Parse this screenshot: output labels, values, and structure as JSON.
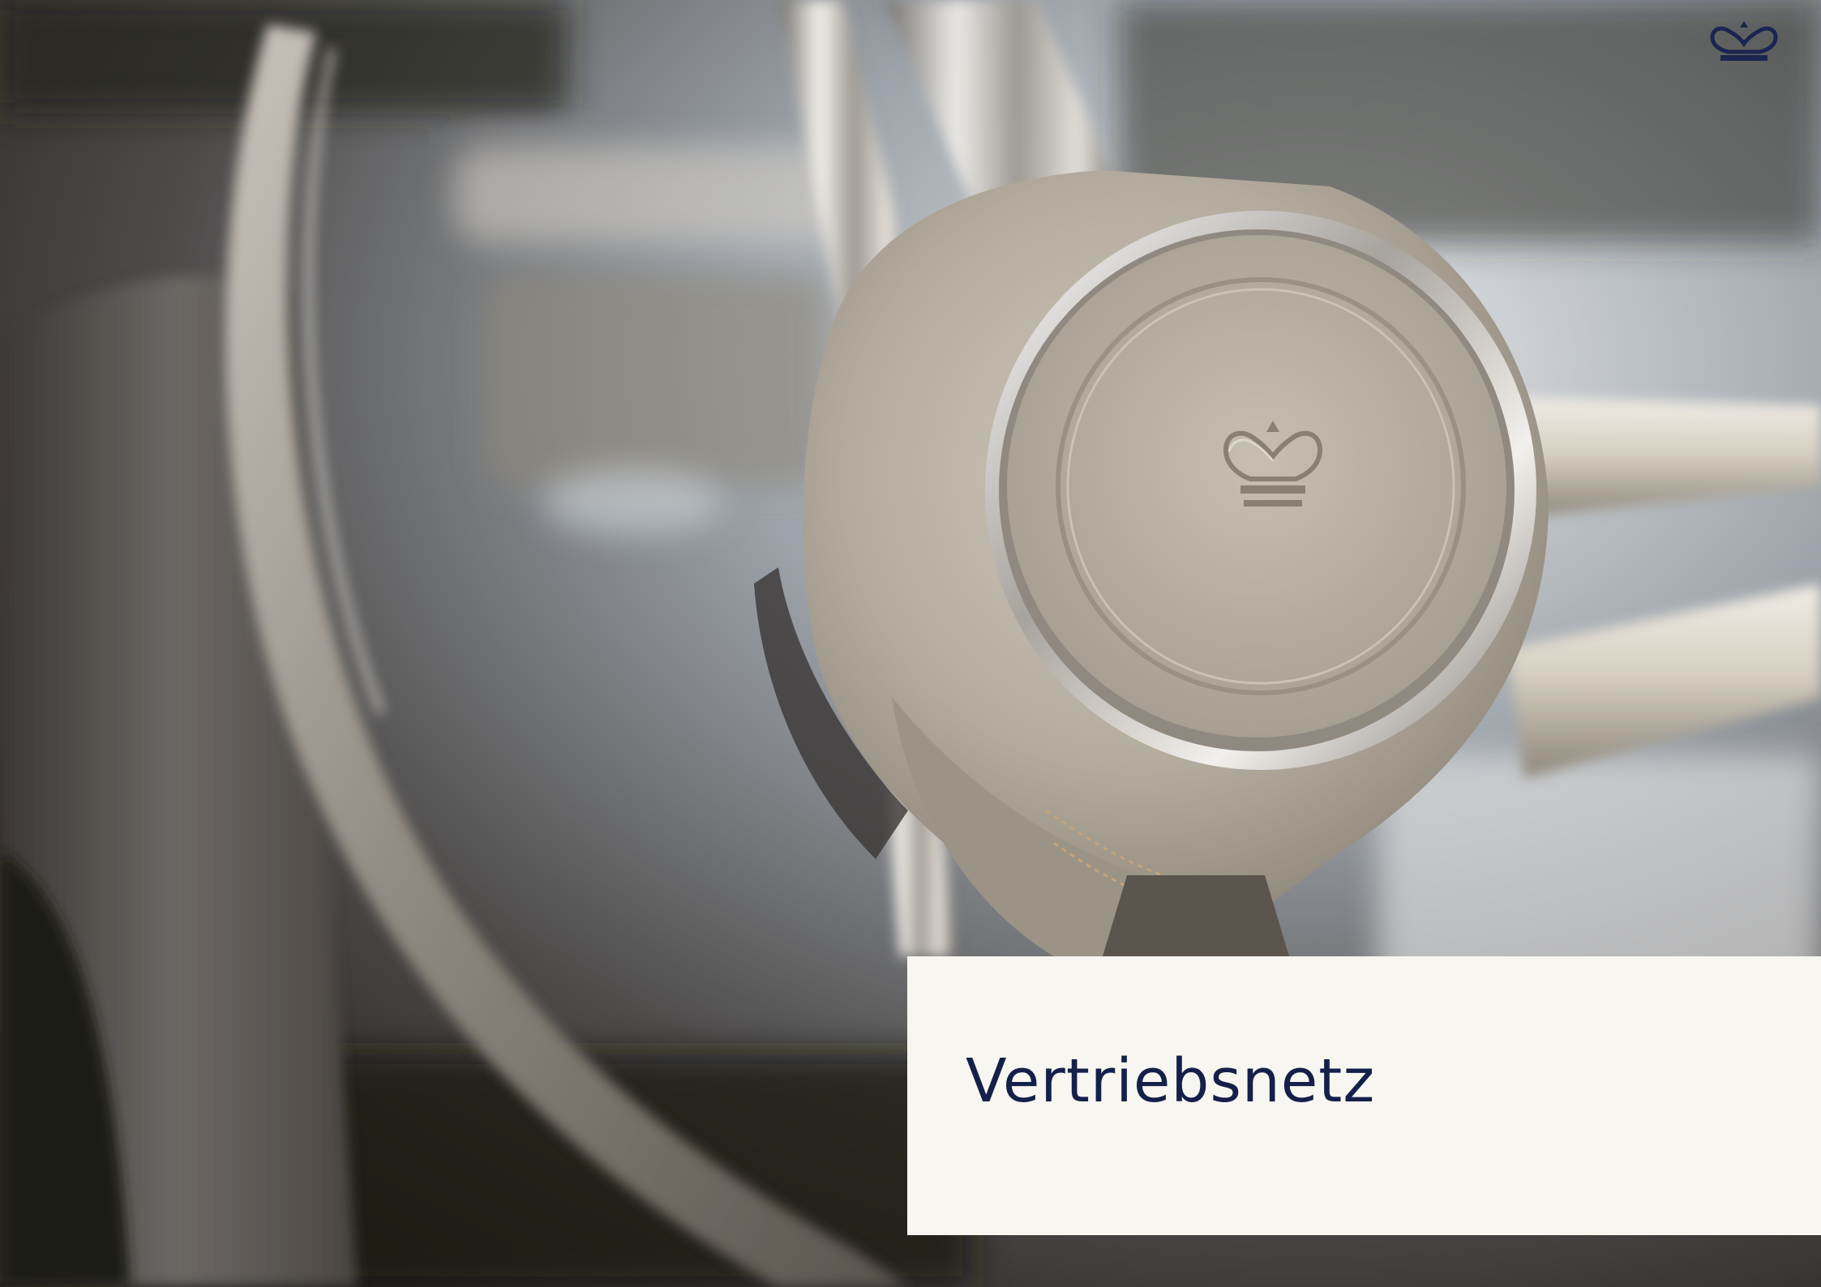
{
  "section": {
    "title": "Vertriebsnetz"
  },
  "brand": {
    "logo_icon": "crown-icon",
    "logo_color": "#1b2550"
  },
  "photo": {
    "subject_icon": "steering-wheel-photo"
  },
  "colors": {
    "title_card_background": "#f8f6f1",
    "title_text": "#15204a"
  }
}
